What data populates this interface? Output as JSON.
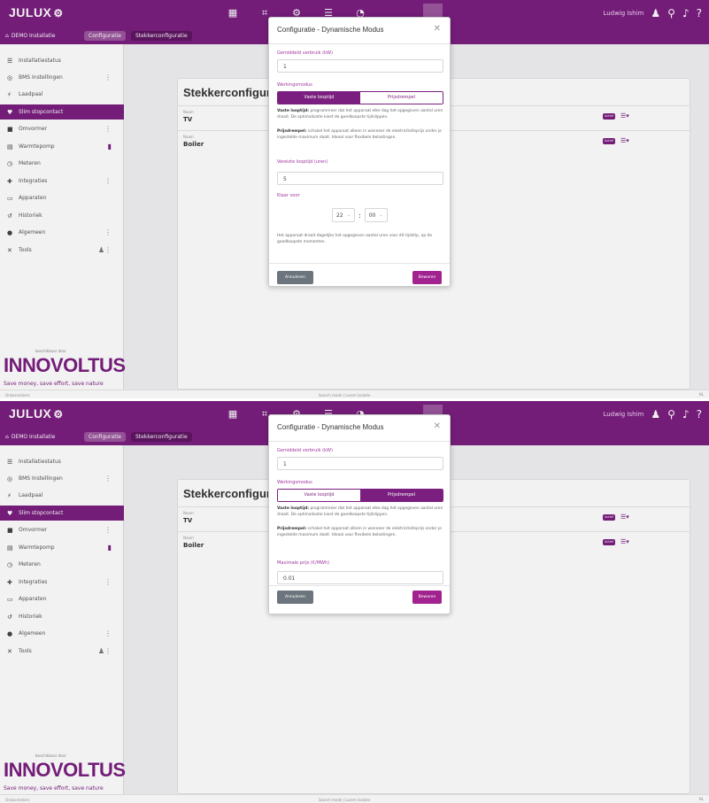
{
  "app": {
    "logo": "JULUX",
    "user": "Ludwig Ishim",
    "breadcrumb": [
      "DEMO Installatie",
      "Configuratie",
      "Stekkerconfiguratie"
    ]
  },
  "sidebar": {
    "items": [
      {
        "label": "Installatiestatus"
      },
      {
        "label": "BMS Instellingen"
      },
      {
        "label": "Laadpaal"
      },
      {
        "label": "Slim stopcontact"
      },
      {
        "label": "Omvormer"
      },
      {
        "label": "Warmtepomp"
      },
      {
        "label": "Meteren"
      },
      {
        "label": "Integraties"
      },
      {
        "label": "Apparaten"
      },
      {
        "label": "Historiek"
      },
      {
        "label": "Algemeen"
      },
      {
        "label": "Tools"
      }
    ],
    "brand_small": "beschikbaar door",
    "brand": "INNOVOLTUS",
    "tagline": "Save money, save effort, save nature"
  },
  "main": {
    "title": "Stekkerconfigur",
    "plugs": [
      {
        "label": "Naam",
        "name": "TV"
      },
      {
        "label": "Naam",
        "name": "Boiler"
      }
    ],
    "badge": "Actief"
  },
  "footer": {
    "left": "Onkosmetiers",
    "center": "Search mode | Lorem Isolatie",
    "right": "NL"
  },
  "modal1": {
    "title": "Configuratie - Dynamische Modus",
    "avg_label": "Gemiddeld verbruik (kW)",
    "avg_value": "1",
    "mode_label": "Werkingsmodus",
    "mode_options": [
      "Vaste looptijd",
      "Prijsdrempel"
    ],
    "selected_mode": "Vaste looptijd",
    "desc1_bold": "Vaste looptijd:",
    "desc1": "programmeer dat het apparaat elke dag het opgegeven aantal uren draait. De optimalisatie kiest de goedkoopste tijdslippen.",
    "desc2_bold": "Prijsdrempel:",
    "desc2": "schakel het apparaat alleen in wanneer de elektriciteitsprijs onder je ingestelde maximum daalt. Ideaal voor flexibele belastingen.",
    "runtime_label": "Vereiste looptijd (uren)",
    "runtime_value": "5",
    "ready_label": "Klaar voor",
    "hour": "22",
    "minute": "00",
    "note": "Het apparaat draait dagelijks het opgegeven aantal uren voor dit tijdstip, op de goedkoopste momenten.",
    "cancel": "Annuleren",
    "save": "Bewaren"
  },
  "modal2": {
    "title": "Configuratie - Dynamische Modus",
    "avg_label": "Gemiddeld verbruik (kW)",
    "avg_value": "1",
    "mode_label": "Werkingsmodus",
    "mode_options": [
      "Vaste looptijd",
      "Prijsdrempel"
    ],
    "selected_mode": "Prijsdrempel",
    "desc1_bold": "Vaste looptijd:",
    "desc1": "programmeer dat het apparaat elke dag het opgegeven aantal uren draait. De optimalisatie kiest de goedkoopste tijdslippen.",
    "desc2_bold": "Prijsdrempel:",
    "desc2": "schakel het apparaat alleen in wanneer de elektriciteitsprijs onder je ingestelde maximum daalt. Ideaal voor flexibele belastingen.",
    "price_label": "Maximale prijs (€/MWh)",
    "price_value": "0.01",
    "cancel": "Annuleren",
    "save": "Bewaren"
  },
  "colors": {
    "brand": "#7a1f7f",
    "accent": "#a2238f",
    "cancel": "#6c757d"
  }
}
